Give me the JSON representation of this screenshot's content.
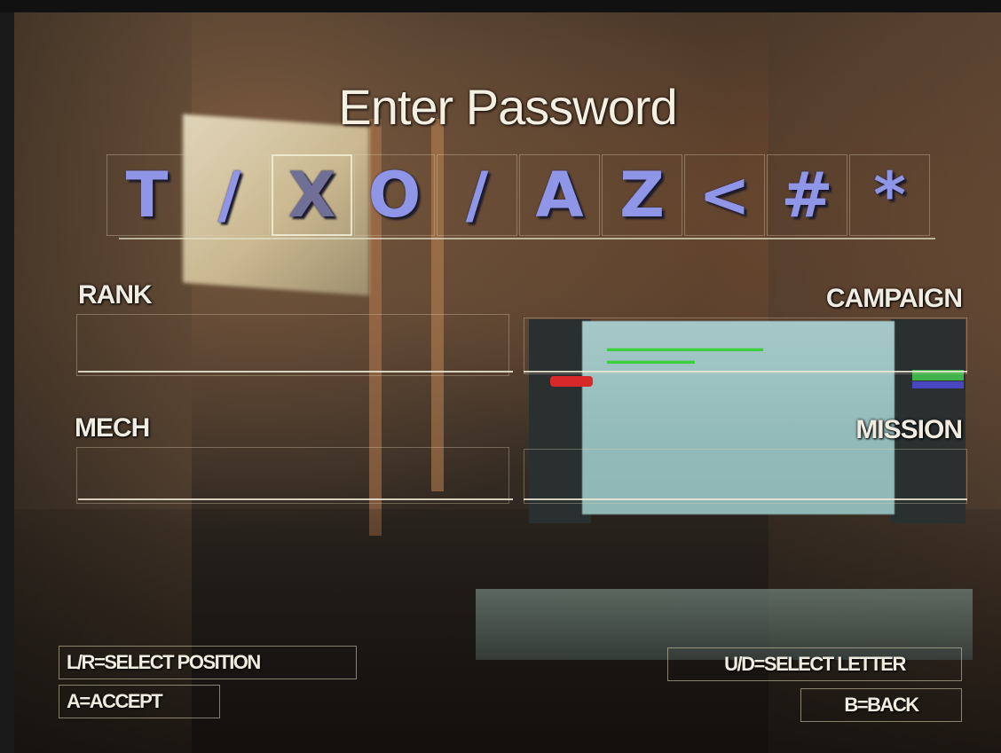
{
  "title": "Enter Password",
  "password_chars": [
    {
      "glyph": "T",
      "selected": false
    },
    {
      "glyph": "/",
      "selected": false
    },
    {
      "glyph": "X",
      "selected": true
    },
    {
      "glyph": "O",
      "selected": false
    },
    {
      "glyph": "/",
      "selected": false
    },
    {
      "glyph": "A",
      "selected": false
    },
    {
      "glyph": "Z",
      "selected": false
    },
    {
      "glyph": "<",
      "selected": false
    },
    {
      "glyph": "#",
      "selected": false
    },
    {
      "glyph": "*",
      "selected": false
    }
  ],
  "fields": {
    "rank": "RANK",
    "campaign": "CAMPAIGN",
    "mech": "MECH",
    "mission": "MISSION"
  },
  "controls": {
    "select_position": "L/R=SELECT POSITION",
    "accept": "A=ACCEPT",
    "select_letter": "U/D=SELECT LETTER",
    "back": "B=BACK"
  },
  "colors": {
    "glyph": "#8f96e8",
    "text": "#f0ece2"
  }
}
